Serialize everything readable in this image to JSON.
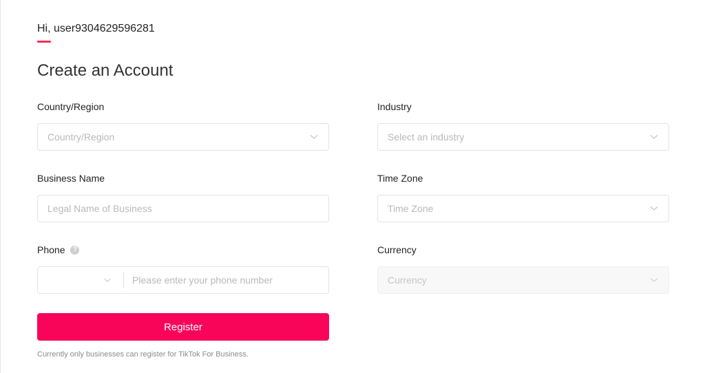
{
  "header": {
    "greeting": "Hi, user9304629596281",
    "title": "Create an Account"
  },
  "form": {
    "country": {
      "label": "Country/Region",
      "placeholder": "Country/Region",
      "icon": "chevron-down-icon"
    },
    "industry": {
      "label": "Industry",
      "placeholder": "Select an industry",
      "icon": "chevron-down-icon"
    },
    "business_name": {
      "label": "Business Name",
      "placeholder": "Legal Name of Business"
    },
    "time_zone": {
      "label": "Time Zone",
      "placeholder": "Time Zone",
      "icon": "chevron-down-icon"
    },
    "phone": {
      "label": "Phone",
      "help_icon": "question-mark-icon",
      "help_glyph": "?",
      "code_value": "",
      "placeholder": "Please enter your phone number"
    },
    "currency": {
      "label": "Currency",
      "placeholder": "Currency",
      "disabled": true,
      "icon": "chevron-down-icon"
    }
  },
  "actions": {
    "register_label": "Register"
  },
  "footnote": "Currently only businesses can register for TikTok For Business.",
  "colors": {
    "accent": "#fe2c55",
    "button": "#f8055a"
  }
}
